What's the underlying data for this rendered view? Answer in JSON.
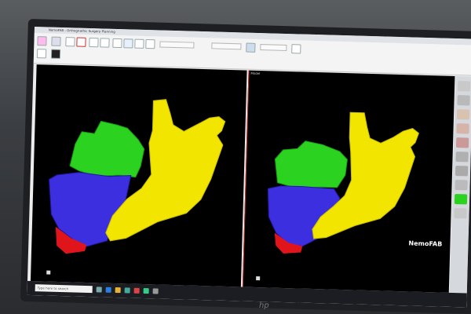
{
  "window": {
    "title": "NemoFAB - Orthognathic Surgery Planning"
  },
  "ribbon": {
    "fields": [
      "",
      "",
      ""
    ],
    "texts": []
  },
  "viewports": {
    "left_label": "",
    "right_label": "Model"
  },
  "brand": "NemoFAB",
  "taskbar": {
    "search_placeholder": "Type here to search"
  },
  "monitor_logo": "hp",
  "colors": {
    "maxilla": "#2bd21f",
    "teeth_lower": "#3b2fe0",
    "chin": "#e0141b",
    "mandible": "#f2e600"
  }
}
